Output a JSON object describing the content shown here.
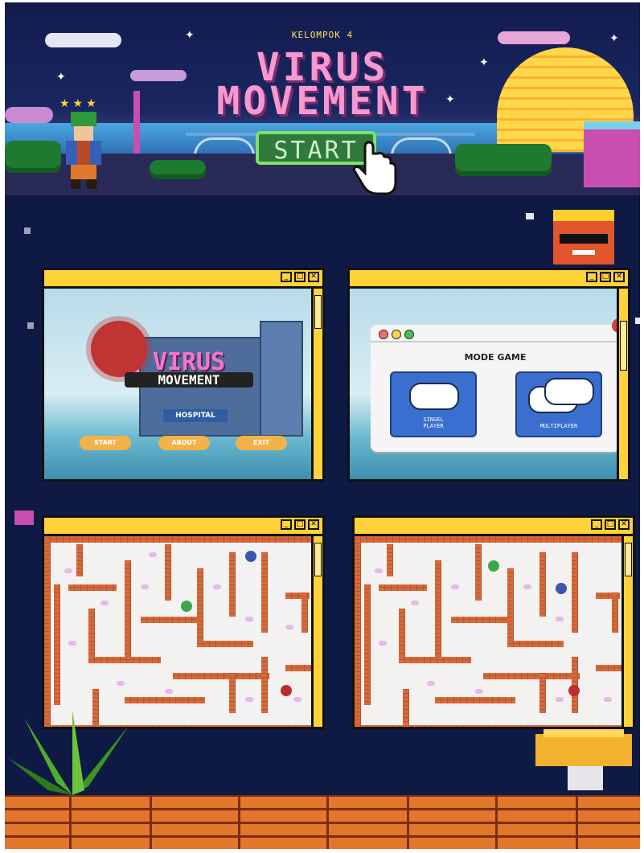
{
  "header": {
    "group_label": "KELOMPOK 4",
    "title_line1": "VIRUS",
    "title_line2": "MOVEMENT",
    "start_label": "START",
    "stars": "★★★"
  },
  "screens": {
    "menu": {
      "logo_title": "VIRUS",
      "logo_subtitle": "MOVEMENT",
      "hospital_sign": "HOSPITAL",
      "buttons": [
        "START",
        "ABOUT",
        "EXIT"
      ]
    },
    "mode": {
      "title": "MODE GAME",
      "close_icon": "close-icon",
      "options": [
        {
          "label_line1": "SINGEL",
          "label_line2": "PLAYER",
          "icon": "gamepad-icon"
        },
        {
          "label_line1": "MULTIPLAYER",
          "label_line2": "",
          "icon": "gamepads-icon"
        }
      ]
    }
  },
  "window_controls": [
    "minimize-icon",
    "maximize-icon",
    "close-icon"
  ],
  "colors": {
    "background": "#0e1a44",
    "window_frame": "#ffd23a",
    "title_pink": "#f49ad0",
    "start_green": "#2f7a3a",
    "maze_wall": "#d8693a",
    "brick": "#e2772c"
  }
}
